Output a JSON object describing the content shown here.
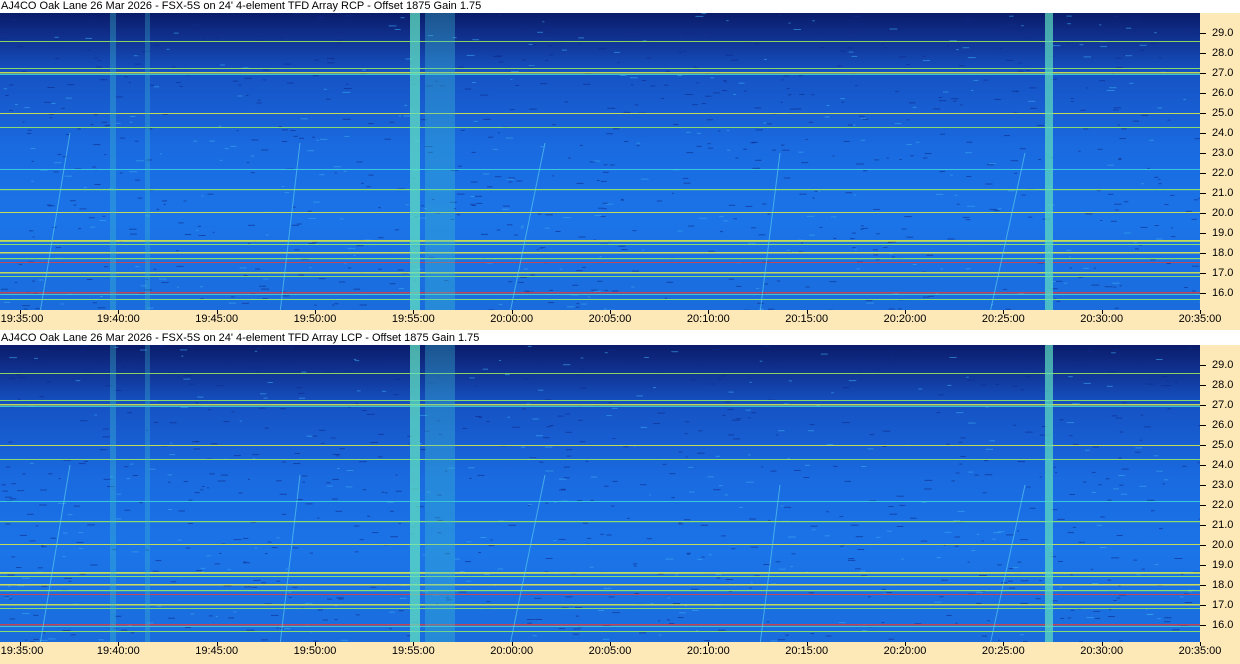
{
  "panels": [
    {
      "title": "AJ4CO Oak Lane 26 Mar 2026 - FSX-5S on 24' 4-element TFD Array RCP  -  Offset 1875  Gain 1.75"
    },
    {
      "title": "AJ4CO Oak Lane 26 Mar 2026 - FSX-5S on 24' 4-element TFD Array LCP  -  Offset 1875  Gain 1.75"
    }
  ],
  "freq_labels": [
    "29.0",
    "28.0",
    "27.0",
    "26.0",
    "25.0",
    "24.0",
    "23.0",
    "22.0",
    "21.0",
    "20.0",
    "19.0",
    "18.0",
    "17.0",
    "16.0"
  ],
  "freq_values": [
    29,
    28,
    27,
    26,
    25,
    24,
    23,
    22,
    21,
    20,
    19,
    18,
    17,
    16
  ],
  "time_labels": [
    "19:35:00",
    "19:40:00",
    "19:45:00",
    "19:50:00",
    "19:55:00",
    "20:00:00",
    "20:05:00",
    "20:10:00",
    "20:15:00",
    "20:20:00",
    "20:25:00",
    "20:30:00",
    "20:35:00"
  ],
  "colors": {
    "axis_bg": "#fde8b8",
    "dark_blue": "#0a1c6a",
    "mid_blue": "#1a6ae0",
    "cyan": "#40d8d8",
    "green": "#9ef05a",
    "yellow": "#f0f040",
    "red": "#e04040"
  }
}
